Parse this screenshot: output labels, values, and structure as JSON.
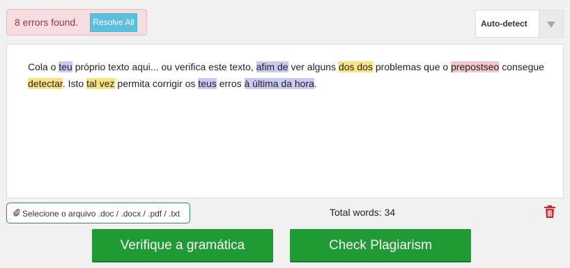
{
  "status": {
    "errors_text": "8 errors found.",
    "resolve_label": "Resolve All"
  },
  "language": {
    "selected": "Auto-detect"
  },
  "editor": {
    "segments": [
      {
        "text": "Cola o ",
        "hl": ""
      },
      {
        "text": "teu",
        "hl": "blue"
      },
      {
        "text": " próprio texto aqui... ou verifica este texto, ",
        "hl": ""
      },
      {
        "text": "afim de",
        "hl": "blue"
      },
      {
        "text": " ver alguns ",
        "hl": ""
      },
      {
        "text": "dos dos",
        "hl": "yellow"
      },
      {
        "text": " problemas que o ",
        "hl": ""
      },
      {
        "text": "prepostseo",
        "hl": "red"
      },
      {
        "text": " consegue ",
        "hl": ""
      },
      {
        "text": "detectar",
        "hl": "yellow"
      },
      {
        "text": ". Isto ",
        "hl": ""
      },
      {
        "text": "tal vez",
        "hl": "yellow"
      },
      {
        "text": " permita corrigir os ",
        "hl": ""
      },
      {
        "text": "teus",
        "hl": "blue"
      },
      {
        "text": " erros ",
        "hl": ""
      },
      {
        "text": "à última da hora",
        "hl": "blue"
      },
      {
        "text": ".",
        "hl": ""
      }
    ]
  },
  "footer": {
    "file_label": "Selecione o arquivo .doc / .docx / .pdf / .txt",
    "file_icon": "paperclip-icon",
    "total_words": "Total words: 34",
    "trash_icon": "trash-icon"
  },
  "actions": {
    "check_grammar": "Verifique a gramática",
    "check_plagiarism": "Check Plagiarism"
  },
  "colors": {
    "highlight_blue": "#c9c9f3",
    "highlight_yellow": "#fbe47f",
    "highlight_red": "#f5c6cb",
    "primary_green": "#1f9b33",
    "info_blue": "#5bc0de",
    "danger_red": "#d9262a"
  }
}
